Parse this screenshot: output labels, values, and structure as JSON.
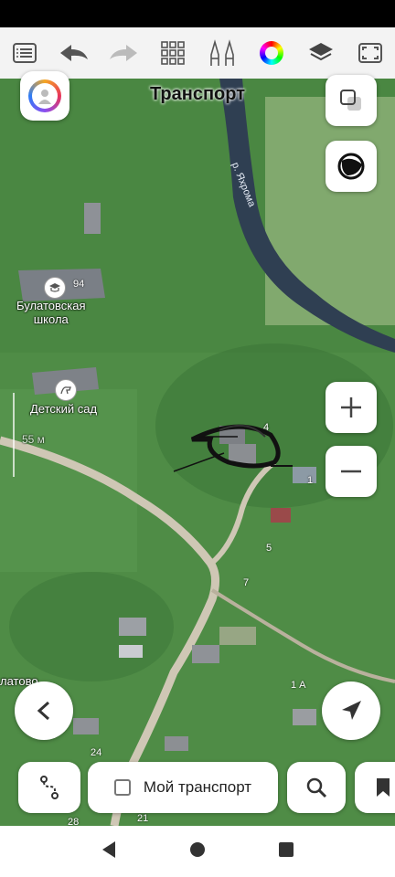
{
  "map": {
    "title": "Транспорт",
    "river_label": "р. Яхрома",
    "places": {
      "school": "Булатовская\nшкола",
      "kindergarten": "Детский сад"
    },
    "house_numbers": [
      "94",
      "4",
      "1",
      "5",
      "7",
      "1 А",
      "24",
      "28",
      "21"
    ],
    "partial_place": "латово",
    "scale_label": "55 м"
  },
  "bottom": {
    "my_transport_label": "Мой транспорт"
  },
  "colors": {
    "grass": "#4e8a45",
    "river": "#2f3f52",
    "road": "#cfc7b5",
    "toolbar_bg": "#f3f3f3"
  }
}
